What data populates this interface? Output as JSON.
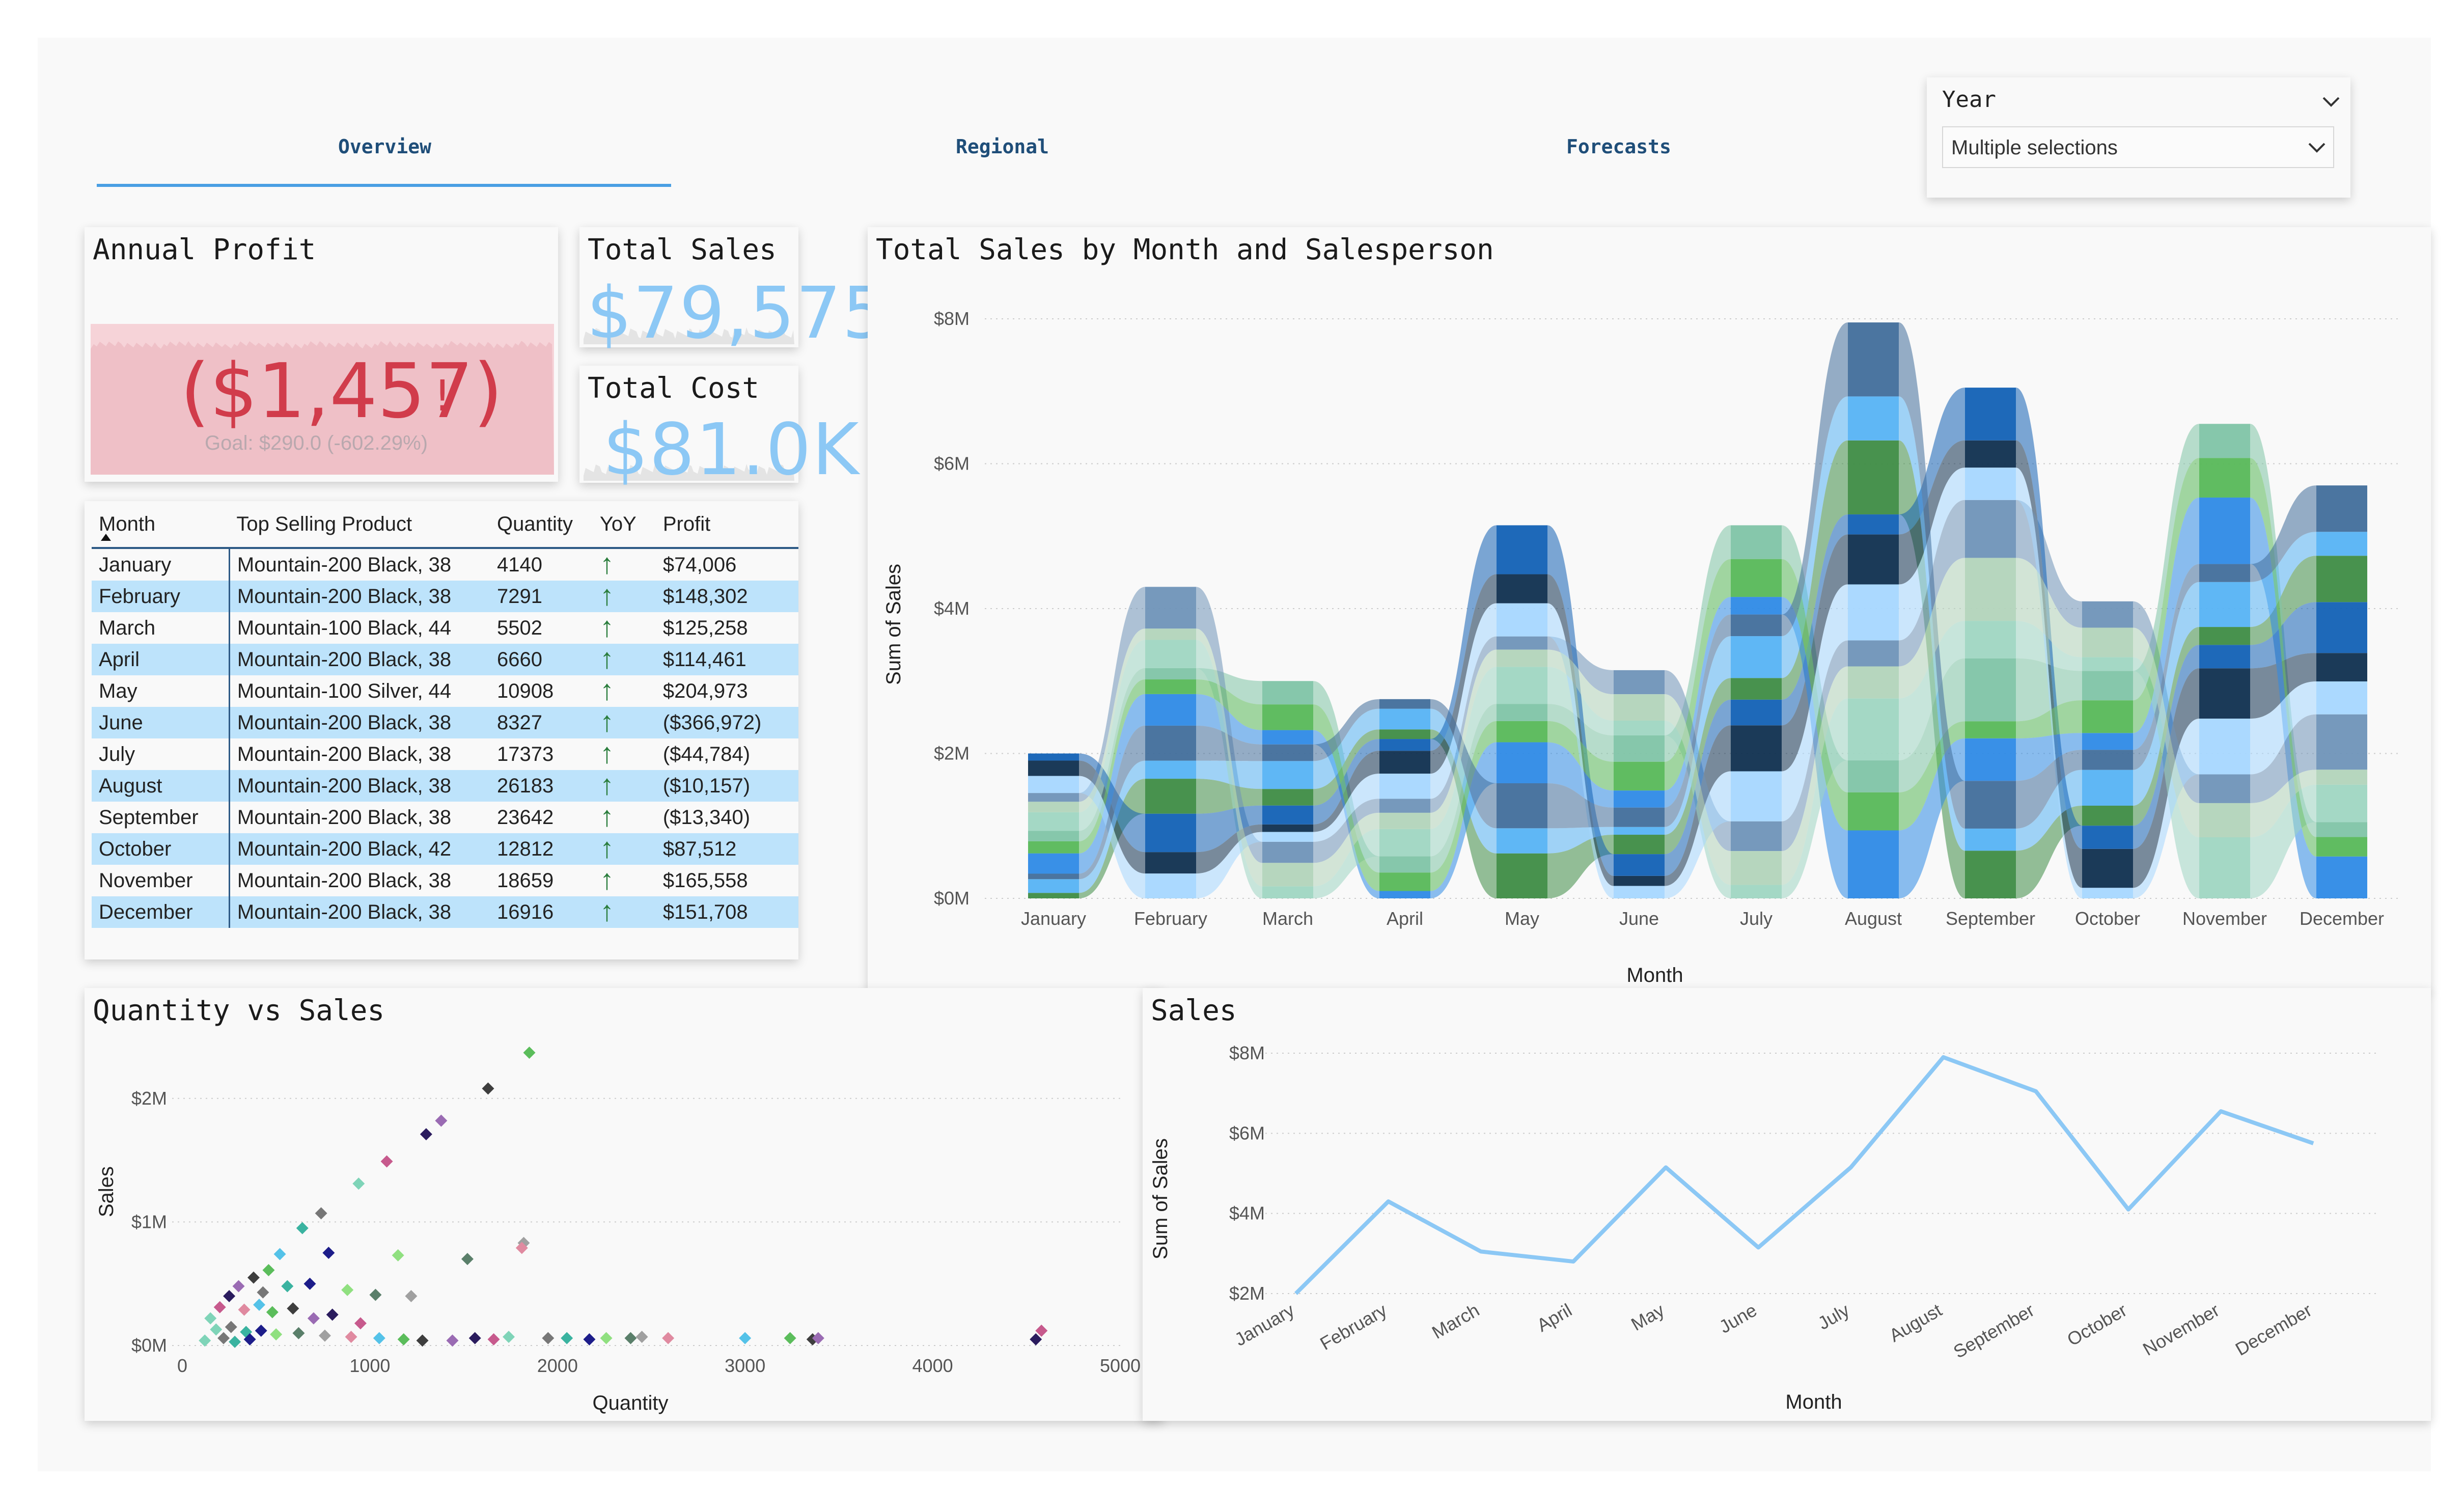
{
  "tabs": [
    {
      "label": "Overview",
      "active": true
    },
    {
      "label": "Regional",
      "active": false
    },
    {
      "label": "Forecasts",
      "active": false
    }
  ],
  "slicer": {
    "label": "Year",
    "value": "Multiple selections",
    "icon": "chevron-down-icon"
  },
  "annual_profit": {
    "title": "Annual Profit",
    "value": "($1,457)",
    "alert": "!",
    "goal": "Goal: $290.0 (-602.29%)",
    "status_color": "#d13c4b",
    "background_color": "#f6d3d8"
  },
  "total_sales": {
    "title": "Total Sales",
    "value": "$79,575"
  },
  "total_cost": {
    "title": "Total Cost",
    "value": "$81.0K"
  },
  "table": {
    "columns": [
      "Month",
      "Top Selling Product",
      "Quantity",
      "YoY",
      "Profit"
    ],
    "sort_icon": "sort-ascending-icon",
    "yoy_icon": "arrow-up-icon",
    "rows": [
      {
        "month": "January",
        "product": "Mountain-200 Black, 38",
        "quantity": "4140",
        "profit": "$74,006",
        "negative": false
      },
      {
        "month": "February",
        "product": "Mountain-200 Black, 38",
        "quantity": "7291",
        "profit": "$148,302",
        "negative": false
      },
      {
        "month": "March",
        "product": "Mountain-100 Black, 44",
        "quantity": "5502",
        "profit": "$125,258",
        "negative": false
      },
      {
        "month": "April",
        "product": "Mountain-200 Black, 38",
        "quantity": "6660",
        "profit": "$114,461",
        "negative": false
      },
      {
        "month": "May",
        "product": "Mountain-100 Silver, 44",
        "quantity": "10908",
        "profit": "$204,973",
        "negative": false
      },
      {
        "month": "June",
        "product": "Mountain-200 Black, 38",
        "quantity": "8327",
        "profit": "($366,972)",
        "negative": true
      },
      {
        "month": "July",
        "product": "Mountain-200 Black, 38",
        "quantity": "17373",
        "profit": "($44,784)",
        "negative": true
      },
      {
        "month": "August",
        "product": "Mountain-200 Black, 38",
        "quantity": "26183",
        "profit": "($10,157)",
        "negative": true
      },
      {
        "month": "September",
        "product": "Mountain-200 Black, 38",
        "quantity": "23642",
        "profit": "($13,340)",
        "negative": true
      },
      {
        "month": "October",
        "product": "Mountain-200 Black, 42",
        "quantity": "12812",
        "profit": "$87,512",
        "negative": false
      },
      {
        "month": "November",
        "product": "Mountain-200 Black, 38",
        "quantity": "18659",
        "profit": "$165,558",
        "negative": false
      },
      {
        "month": "December",
        "product": "Mountain-200 Black, 38",
        "quantity": "16916",
        "profit": "$151,708",
        "negative": false
      }
    ]
  },
  "ribbon_chart": {
    "title": "Total Sales by Month and Salesperson",
    "xlabel": "Month",
    "ylabel": "Sum of Sales",
    "yticks": [
      "$0M",
      "$2M",
      "$4M",
      "$6M",
      "$8M"
    ],
    "months": [
      "January",
      "February",
      "March",
      "April",
      "May",
      "June",
      "July",
      "August",
      "September",
      "October",
      "November",
      "December"
    ],
    "totals_m": [
      2.0,
      4.3,
      3.0,
      2.75,
      5.15,
      3.15,
      5.15,
      7.95,
      7.05,
      4.1,
      6.55,
      5.7
    ],
    "colors": [
      "#3e8c45",
      "#7fc4a6",
      "#0f2f4f",
      "#2e8ae6",
      "#6f93b8",
      "#56b3f4",
      "#9fd6c2",
      "#1261b5",
      "#57b858",
      "#a6d7ff",
      "#416e9b",
      "#b2d4ba"
    ]
  },
  "scatter": {
    "title": "Quantity vs Sales",
    "xlabel": "Quantity",
    "ylabel": "Sales",
    "xticks": [
      "0",
      "1000",
      "2000",
      "3000",
      "4000",
      "5000"
    ],
    "yticks": [
      "$0M",
      "$1M",
      "$2M"
    ]
  },
  "line_chart": {
    "title": "Sales",
    "xlabel": "Month",
    "ylabel": "Sum of Sales",
    "yticks": [
      "$2M",
      "$4M",
      "$6M",
      "$8M"
    ],
    "line_color": "#8cc8f5"
  },
  "chart_data": [
    {
      "type": "area",
      "title": "Total Sales by Month and Salesperson",
      "xlabel": "Month",
      "ylabel": "Sum of Sales",
      "categories": [
        "January",
        "February",
        "March",
        "April",
        "May",
        "June",
        "July",
        "August",
        "September",
        "October",
        "November",
        "December"
      ],
      "values": [
        2.0,
        4.3,
        3.0,
        2.75,
        5.15,
        3.15,
        5.15,
        7.95,
        7.05,
        4.1,
        6.55,
        5.7
      ],
      "unit": "$M",
      "ylim": [
        0,
        8
      ],
      "grid": true
    },
    {
      "type": "scatter",
      "title": "Quantity vs Sales",
      "xlabel": "Quantity",
      "ylabel": "Sales",
      "xlim": [
        0,
        5000
      ],
      "ylim": [
        0,
        2.3
      ],
      "unit_y": "$M",
      "points": [
        [
          1850,
          2.37
        ],
        [
          1630,
          2.08
        ],
        [
          1380,
          1.82
        ],
        [
          1300,
          1.71
        ],
        [
          1090,
          1.49
        ],
        [
          940,
          1.31
        ],
        [
          740,
          1.07
        ],
        [
          640,
          0.95
        ],
        [
          780,
          0.75
        ],
        [
          1150,
          0.73
        ],
        [
          1520,
          0.7
        ],
        [
          1820,
          0.83
        ],
        [
          1810,
          0.79
        ],
        [
          520,
          0.74
        ],
        [
          460,
          0.61
        ],
        [
          380,
          0.55
        ],
        [
          300,
          0.48
        ],
        [
          250,
          0.4
        ],
        [
          200,
          0.31
        ],
        [
          150,
          0.22
        ],
        [
          430,
          0.43
        ],
        [
          560,
          0.48
        ],
        [
          680,
          0.5
        ],
        [
          880,
          0.45
        ],
        [
          1030,
          0.41
        ],
        [
          1220,
          0.4
        ],
        [
          330,
          0.29
        ],
        [
          410,
          0.33
        ],
        [
          480,
          0.27
        ],
        [
          590,
          0.3
        ],
        [
          700,
          0.22
        ],
        [
          800,
          0.25
        ],
        [
          950,
          0.18
        ],
        [
          180,
          0.13
        ],
        [
          260,
          0.15
        ],
        [
          340,
          0.11
        ],
        [
          420,
          0.12
        ],
        [
          500,
          0.09
        ],
        [
          620,
          0.1
        ],
        [
          760,
          0.08
        ],
        [
          900,
          0.07
        ],
        [
          1050,
          0.06
        ],
        [
          1180,
          0.05
        ],
        [
          1280,
          0.04
        ],
        [
          1440,
          0.04
        ],
        [
          1560,
          0.06
        ],
        [
          1660,
          0.05
        ],
        [
          1740,
          0.07
        ],
        [
          1950,
          0.06
        ],
        [
          2050,
          0.06
        ],
        [
          2170,
          0.05
        ],
        [
          2260,
          0.06
        ],
        [
          2390,
          0.06
        ],
        [
          2450,
          0.07
        ],
        [
          2590,
          0.06
        ],
        [
          3000,
          0.06
        ],
        [
          3240,
          0.06
        ],
        [
          3360,
          0.05
        ],
        [
          3390,
          0.06
        ],
        [
          4550,
          0.05
        ],
        [
          4580,
          0.12
        ],
        [
          120,
          0.04
        ],
        [
          220,
          0.06
        ],
        [
          280,
          0.03
        ],
        [
          360,
          0.05
        ]
      ]
    },
    {
      "type": "line",
      "title": "Sales",
      "xlabel": "Month",
      "ylabel": "Sum of Sales",
      "categories": [
        "January",
        "February",
        "March",
        "April",
        "May",
        "June",
        "July",
        "August",
        "September",
        "October",
        "November",
        "December"
      ],
      "values": [
        2.0,
        4.3,
        3.05,
        2.8,
        5.15,
        3.15,
        5.15,
        7.9,
        7.05,
        4.1,
        6.55,
        5.75
      ],
      "unit": "$M",
      "ylim": [
        2,
        8
      ],
      "grid": true
    }
  ]
}
